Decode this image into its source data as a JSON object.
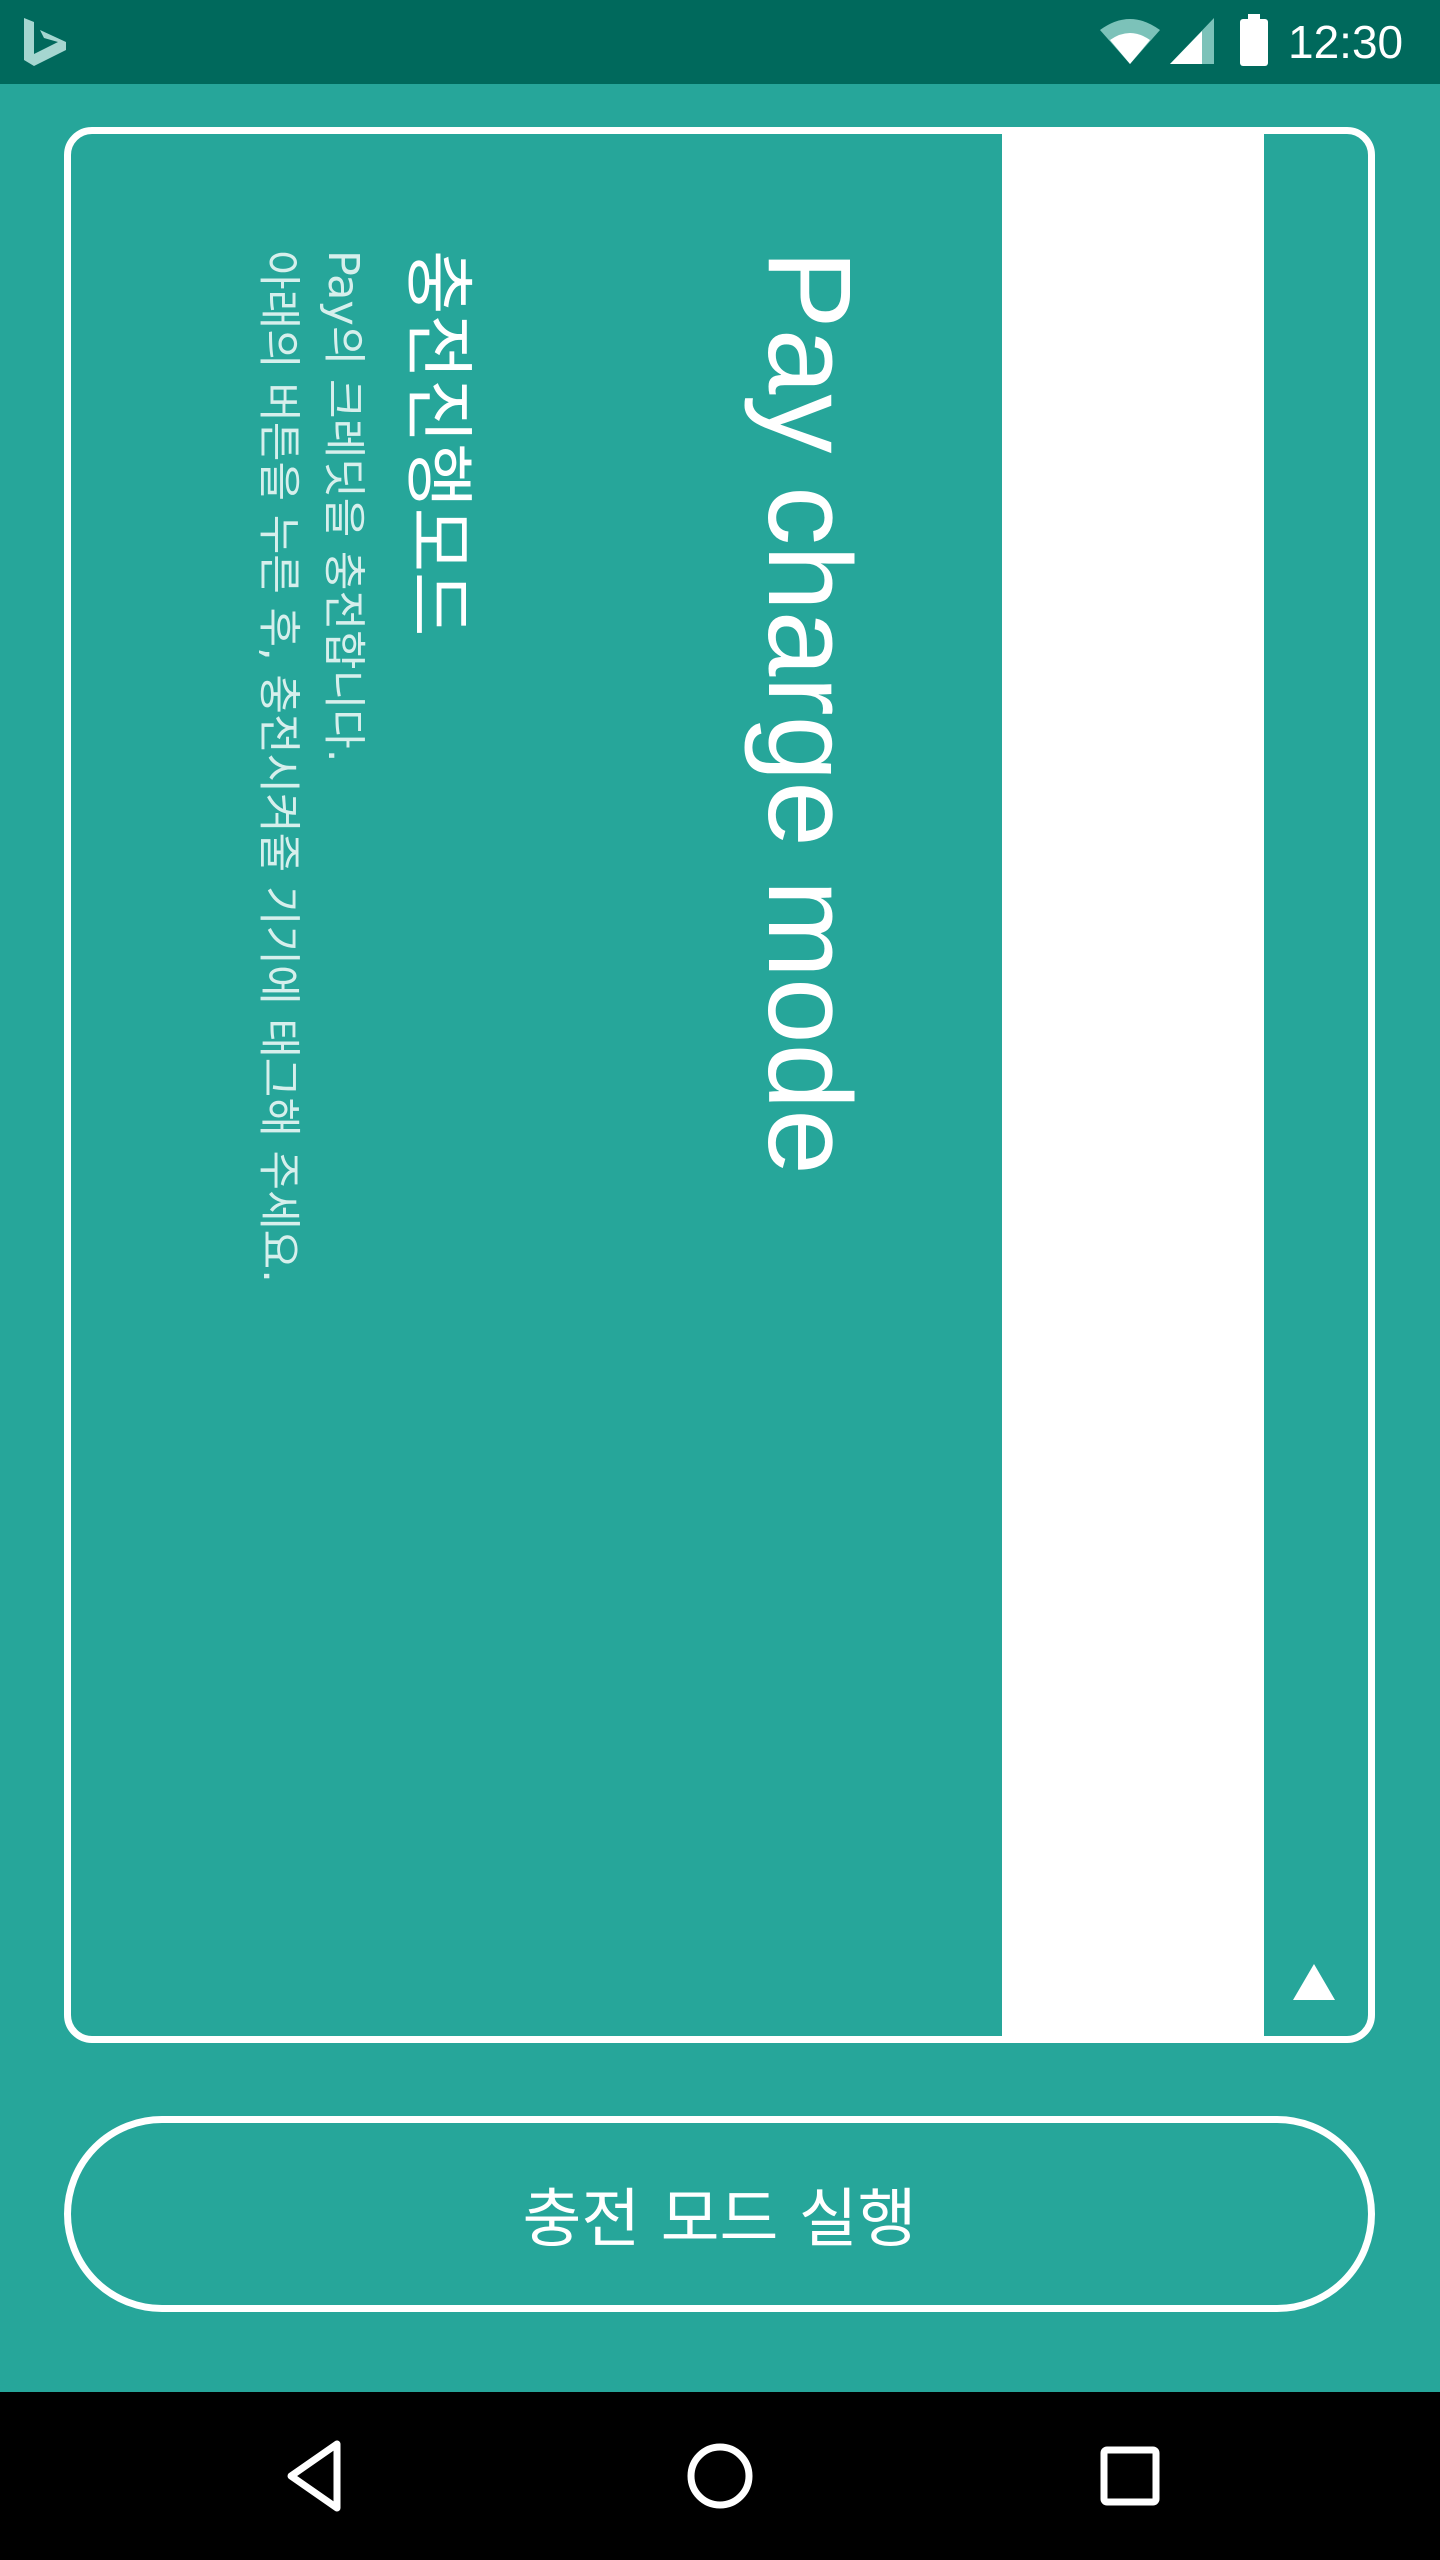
{
  "status_bar": {
    "time": "12:30",
    "icons": [
      "bing-logo-icon",
      "wifi-icon",
      "cell-signal-icon",
      "battery-icon"
    ]
  },
  "card": {
    "title_en": "Pay charge mode",
    "title_ko": "충전진행모드",
    "description_line1": "Pay의 크레딧을 충전합니다.",
    "description_line2": "아래의 버튼을 누른 후, 충전시켜줄 기기에 태그해 주세요.",
    "expand_icon": "triangle-up-icon"
  },
  "run_button": {
    "label": "충전 모드 실행"
  },
  "nav_bar": {
    "icons": [
      "back-icon",
      "home-icon",
      "recents-icon"
    ]
  },
  "colors": {
    "background": "#26A69A",
    "status_bar": "#00695C",
    "accent_white": "#FFFFFF",
    "secondary_text": "#D6EFEC",
    "nav_bar": "#000000"
  }
}
